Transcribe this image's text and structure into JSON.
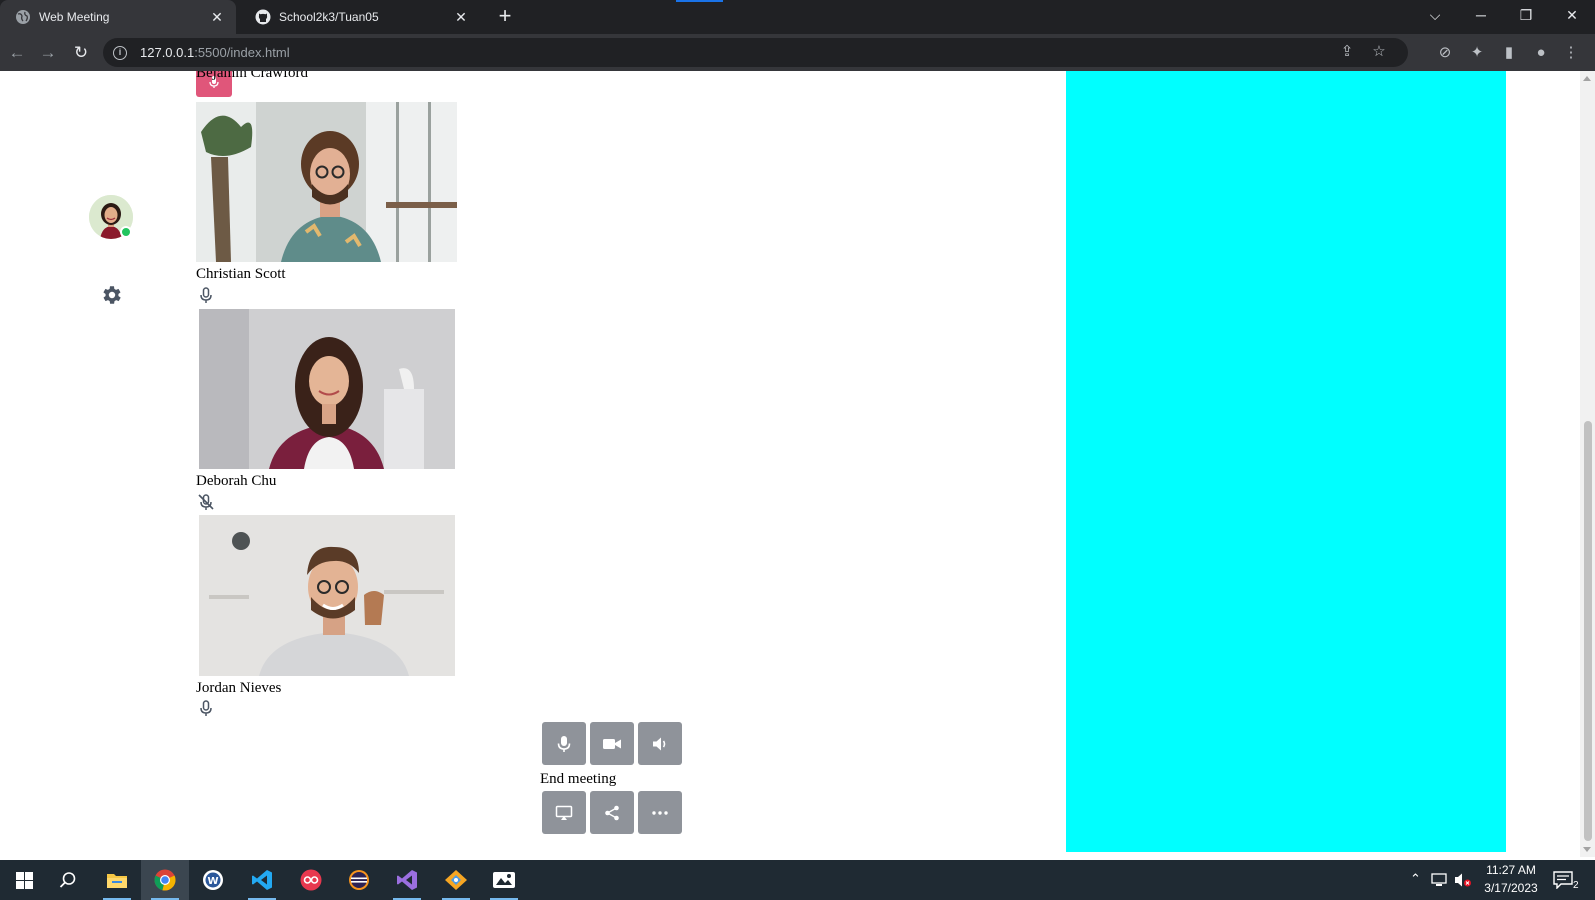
{
  "browser": {
    "tabs": [
      {
        "title": "Web Meeting",
        "active": true,
        "icon": "globe-icon"
      },
      {
        "title": "School2k3/Tuan05",
        "active": false,
        "icon": "github-icon"
      }
    ],
    "url_host": "127.0.0.1",
    "url_rest": ":5500/index.html"
  },
  "sidebar": {
    "user_status": "online",
    "user_status_color": "#22c55e",
    "settings_icon": "gear-icon"
  },
  "participants": [
    {
      "name": "Bejamin Crawford",
      "mic": "active"
    },
    {
      "name": "Christian Scott",
      "mic": "on"
    },
    {
      "name": "Deborah Chu",
      "mic": "muted"
    },
    {
      "name": "Jordan Nieves",
      "mic": "on"
    }
  ],
  "controls": {
    "row1": [
      {
        "icon": "microphone-icon"
      },
      {
        "icon": "video-camera-icon"
      },
      {
        "icon": "speaker-icon"
      }
    ],
    "end_meeting_label": "End meeting",
    "row2": [
      {
        "icon": "screen-share-icon"
      },
      {
        "icon": "share-icon"
      },
      {
        "icon": "more-icon"
      }
    ]
  },
  "colors": {
    "panel": "#00ffff",
    "button": "#8f939a",
    "mic_active": "#e0567a"
  },
  "taskbar": {
    "time": "11:27 AM",
    "date": "3/17/2023",
    "notifications": "2",
    "apps": [
      "file-explorer-icon",
      "chrome-icon",
      "word-icon",
      "vscode-icon",
      "flickr-icon",
      "eclipse-icon",
      "visual-studio-icon",
      "git-icon",
      "paint-icon"
    ]
  }
}
